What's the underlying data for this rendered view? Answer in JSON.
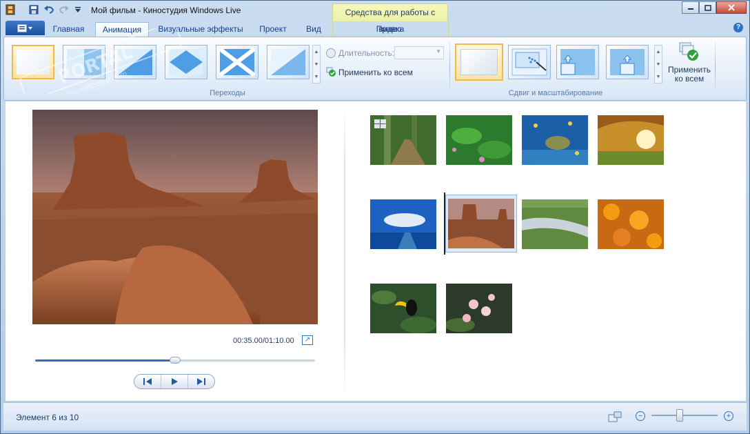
{
  "window": {
    "title": "Мой фильм - Киностудия Windows Live",
    "controls": [
      "minimize",
      "maximize",
      "close"
    ]
  },
  "quick_access": {
    "icons": [
      "film-icon",
      "save-icon",
      "undo-icon",
      "redo-icon",
      "dropdown-icon"
    ]
  },
  "context_tab_group": {
    "label": "Средства для работы с видео"
  },
  "tabs": [
    {
      "label": "Главная"
    },
    {
      "label": "Анимация",
      "active": true
    },
    {
      "label": "Визуальные эффекты"
    },
    {
      "label": "Проект"
    },
    {
      "label": "Вид"
    },
    {
      "label": "Правка"
    }
  ],
  "ribbon": {
    "transitions_group": {
      "label": "Переходы",
      "duration_label": "Длительность:",
      "duration_value": "",
      "apply_all_label": "Применить ко всем"
    },
    "panzoom_group": {
      "label": "Сдвиг и масштабирование"
    },
    "apply_all_big": {
      "line1": "Применить",
      "line2": "ко всем"
    }
  },
  "preview": {
    "time": "00:35.00/01:10.00",
    "progress": 0.5
  },
  "storyboard": {
    "items": [
      {
        "name": "forest-road"
      },
      {
        "name": "green-plants"
      },
      {
        "name": "sea-turtle"
      },
      {
        "name": "autumn-tree"
      },
      {
        "name": "blue-sky-sea"
      },
      {
        "name": "desert-monument",
        "selected": true
      },
      {
        "name": "stream"
      },
      {
        "name": "orange-flowers"
      },
      {
        "name": "toucan"
      },
      {
        "name": "pink-flowers"
      }
    ]
  },
  "status": {
    "text": "Элемент 6 из 10",
    "zoom_level": 0.4
  },
  "watermark": {
    "text": "PORTAL",
    "url": "www.softportal.com"
  }
}
